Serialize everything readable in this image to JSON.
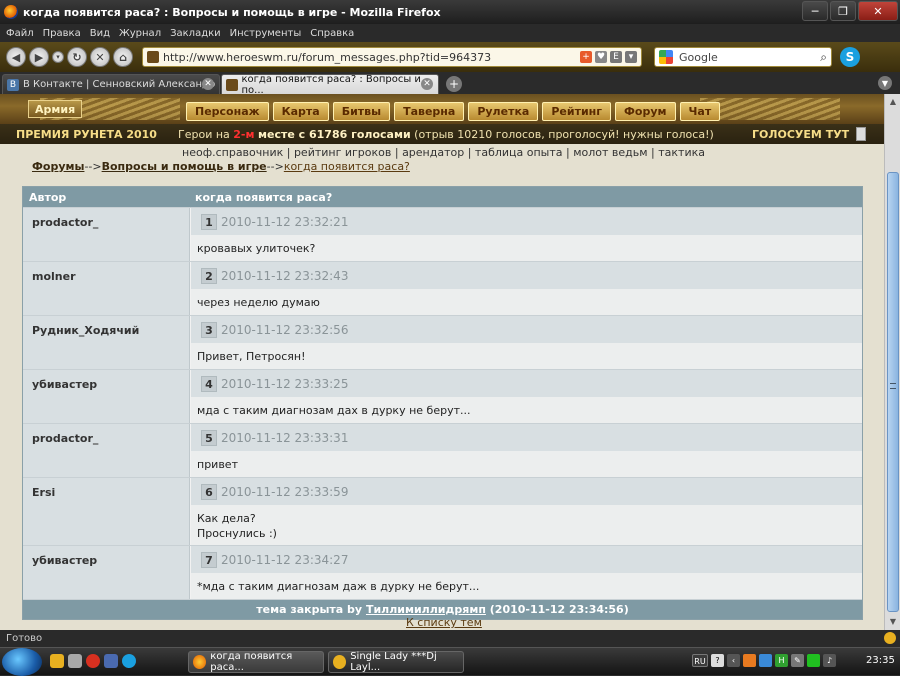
{
  "window": {
    "title": "когда появится раса? : Вопросы и помощь в игре - Mozilla Firefox",
    "minimize": "─",
    "maximize": "❐",
    "close": "✕"
  },
  "menu": [
    "Файл",
    "Правка",
    "Вид",
    "Журнал",
    "Закладки",
    "Инструменты",
    "Справка"
  ],
  "nav": {
    "url": "http://www.heroeswm.ru/forum_messages.php?tid=964373",
    "search_placeholder": "Google"
  },
  "tabs": [
    {
      "label": "В Контакте | Сенновский Александр",
      "icon": "vk-icon"
    },
    {
      "label": "когда появится раса? : Вопросы и по...",
      "icon": "heroes-icon"
    }
  ],
  "game_menu": {
    "army": "Армия",
    "items": [
      "Персонаж",
      "Карта",
      "Битвы",
      "Таверна",
      "Рулетка",
      "Рейтинг",
      "Форум",
      "Чат"
    ]
  },
  "premium": {
    "left": "ПРЕМИЯ РУНЕТА 2010",
    "mid_prefix": "Герои на",
    "mid_place": "2-м",
    "mid_bold": "месте с 61786 голосами",
    "mid_suffix": "(отрыв 10210 голосов, проголосуй! нужны голоса!)",
    "right": "ГОЛОСУЕМ ТУТ"
  },
  "links": "неоф.справочник | рейтинг игроков | арендатор | таблица опыта | молот ведьм | тактика",
  "breadcrumb": {
    "forums": "Форумы",
    "sep1": "-->",
    "section": "Вопросы и помощь в игре",
    "sep2": "-->",
    "topic": "когда появится раса?"
  },
  "table": {
    "col_author": "Автор",
    "col_topic": "когда появится раса?",
    "posts": [
      {
        "author": "prodactor_",
        "num": "1",
        "date": "2010-11-12 23:32:21",
        "text": "кровавых улиточек?"
      },
      {
        "author": "molner",
        "num": "2",
        "date": "2010-11-12 23:32:43",
        "text": "через неделю думаю"
      },
      {
        "author": "Рудник_Ходячий",
        "num": "3",
        "date": "2010-11-12 23:32:56",
        "text": "Привет, Петросян!"
      },
      {
        "author": "убивастер",
        "num": "4",
        "date": "2010-11-12 23:33:25",
        "text": "мда с таким диагнозам дах в дурку не берут..."
      },
      {
        "author": "prodactor_",
        "num": "5",
        "date": "2010-11-12 23:33:31",
        "text": "привет"
      },
      {
        "author": "Ersi",
        "num": "6",
        "date": "2010-11-12 23:33:59",
        "text": "Как дела?\nПроснулись :)"
      },
      {
        "author": "убивастер",
        "num": "7",
        "date": "2010-11-12 23:34:27",
        "text": "*мда с таким диагнозам даж в дурку не берут..."
      }
    ],
    "footer_prefix": "тема закрыта by",
    "footer_user": "Тиллимиллидрямп",
    "footer_suffix": "(2010-11-12 23:34:56)"
  },
  "back_link": "К списку тем",
  "status": "Готово",
  "taskbar": {
    "tasks": [
      "когда появится раса...",
      "Single Lady ***Dj Layl..."
    ],
    "lang": "RU",
    "clock": "23:35"
  }
}
